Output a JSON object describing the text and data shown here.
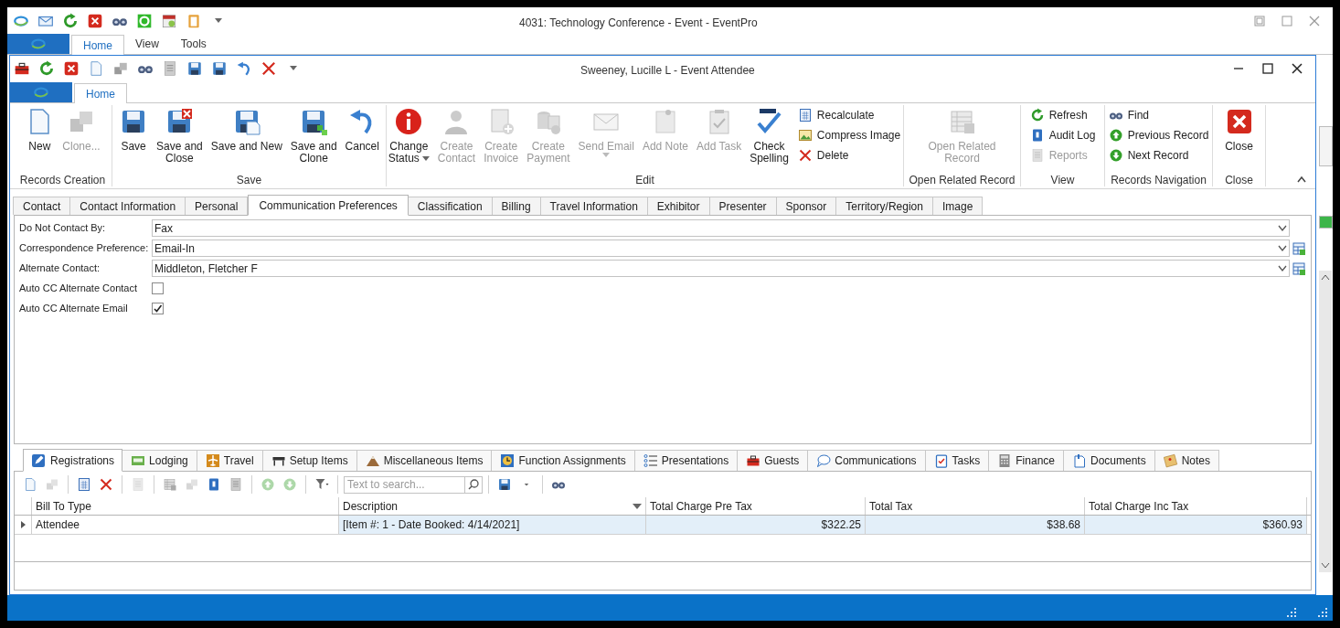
{
  "main_window": {
    "title": "4031: Technology Conference - Event - EventPro",
    "ribbon_tabs": [
      {
        "label": "Home",
        "selected": true
      },
      {
        "label": "View",
        "selected": false
      },
      {
        "label": "Tools",
        "selected": false
      }
    ]
  },
  "attendee_window": {
    "title": "Sweeney, Lucille L - Event Attendee",
    "ribbon_tabs": [
      {
        "label": "Home",
        "selected": true
      }
    ]
  },
  "ribbon_groups": [
    {
      "title": "Records Creation",
      "items": [
        {
          "kind": "large",
          "label": "New",
          "disabled": false
        },
        {
          "kind": "large",
          "label": "Clone...",
          "disabled": true
        }
      ]
    },
    {
      "title": "Save",
      "items": [
        {
          "kind": "large",
          "label": "Save",
          "disabled": false
        },
        {
          "kind": "large",
          "label": "Save and\nClose",
          "disabled": false
        },
        {
          "kind": "large",
          "label": "Save and New",
          "disabled": false
        },
        {
          "kind": "large",
          "label": "Save and\nClone",
          "disabled": false
        },
        {
          "kind": "large",
          "label": "Cancel",
          "disabled": false
        }
      ]
    },
    {
      "title": "Edit",
      "items": [
        {
          "kind": "large",
          "label": "Change\nStatus",
          "disabled": false,
          "dropdown": true
        },
        {
          "kind": "large",
          "label": "Create\nContact",
          "disabled": true
        },
        {
          "kind": "large",
          "label": "Create\nInvoice",
          "disabled": true
        },
        {
          "kind": "large",
          "label": "Create\nPayment",
          "disabled": true
        },
        {
          "kind": "large",
          "label": "Send Email",
          "disabled": true,
          "dropdown": true
        },
        {
          "kind": "large",
          "label": "Add Note",
          "disabled": true
        },
        {
          "kind": "large",
          "label": "Add Task",
          "disabled": true
        },
        {
          "kind": "large",
          "label": "Check\nSpelling",
          "disabled": false
        },
        {
          "kind": "small",
          "label": "Recalculate",
          "disabled": false
        },
        {
          "kind": "small",
          "label": "Compress Image",
          "disabled": false
        },
        {
          "kind": "small",
          "label": "Delete",
          "disabled": false
        }
      ]
    },
    {
      "title": "Open Related Record",
      "items": [
        {
          "kind": "large",
          "label": "Open Related\nRecord",
          "disabled": true
        }
      ]
    },
    {
      "title": "View",
      "items": [
        {
          "kind": "small",
          "label": "Refresh",
          "disabled": false
        },
        {
          "kind": "small",
          "label": "Audit Log",
          "disabled": false
        },
        {
          "kind": "small",
          "label": "Reports",
          "disabled": true
        }
      ]
    },
    {
      "title": "Records Navigation",
      "items": [
        {
          "kind": "small",
          "label": "Find",
          "disabled": false
        },
        {
          "kind": "small",
          "label": "Previous Record",
          "disabled": false
        },
        {
          "kind": "small",
          "label": "Next Record",
          "disabled": false
        }
      ]
    },
    {
      "title": "Close",
      "items": [
        {
          "kind": "large",
          "label": "Close",
          "disabled": false
        }
      ]
    }
  ],
  "record_tabs": [
    {
      "label": "Contact",
      "selected": false
    },
    {
      "label": "Contact Information",
      "selected": false
    },
    {
      "label": "Personal",
      "selected": false
    },
    {
      "label": "Communication Preferences",
      "selected": true
    },
    {
      "label": "Classification",
      "selected": false
    },
    {
      "label": "Billing",
      "selected": false
    },
    {
      "label": "Travel Information",
      "selected": false
    },
    {
      "label": "Exhibitor",
      "selected": false
    },
    {
      "label": "Presenter",
      "selected": false
    },
    {
      "label": "Sponsor",
      "selected": false
    },
    {
      "label": "Territory/Region",
      "selected": false
    },
    {
      "label": "Image",
      "selected": false
    }
  ],
  "fields": [
    {
      "kind": "combo",
      "label": "Do Not Contact By:",
      "value": "Fax",
      "lookup": false
    },
    {
      "kind": "combo",
      "label": "Correspondence Preference:",
      "value": "Email-In",
      "lookup": true
    },
    {
      "kind": "combo",
      "label": "Alternate Contact:",
      "value": "Middleton, Fletcher F",
      "lookup": true
    },
    {
      "kind": "checkbox",
      "label": "Auto CC Alternate Contact",
      "checked": false
    },
    {
      "kind": "checkbox",
      "label": "Auto CC Alternate Email",
      "checked": true
    }
  ],
  "detail_tabs": [
    {
      "label": "Registrations",
      "selected": true
    },
    {
      "label": "Lodging",
      "selected": false
    },
    {
      "label": "Travel",
      "selected": false
    },
    {
      "label": "Setup Items",
      "selected": false
    },
    {
      "label": "Miscellaneous Items",
      "selected": false
    },
    {
      "label": "Function Assignments",
      "selected": false
    },
    {
      "label": "Presentations",
      "selected": false
    },
    {
      "label": "Guests",
      "selected": false
    },
    {
      "label": "Communications",
      "selected": false
    },
    {
      "label": "Tasks",
      "selected": false
    },
    {
      "label": "Finance",
      "selected": false
    },
    {
      "label": "Documents",
      "selected": false
    },
    {
      "label": "Notes",
      "selected": false
    }
  ],
  "search": {
    "placeholder": "Text to search..."
  },
  "grid": {
    "columns": [
      {
        "label": "Bill To Type",
        "dropdown": false
      },
      {
        "label": "Description",
        "dropdown": true
      },
      {
        "label": "Total Charge Pre Tax",
        "dropdown": false
      },
      {
        "label": "Total Tax",
        "dropdown": false
      },
      {
        "label": "Total Charge Inc Tax",
        "dropdown": false
      }
    ],
    "rows": [
      {
        "selected": true,
        "cells": [
          "Attendee",
          "[Item #: 1 - Date Booked: 4/14/2021]",
          "$322.25",
          "$38.68",
          "$360.93"
        ]
      }
    ]
  }
}
